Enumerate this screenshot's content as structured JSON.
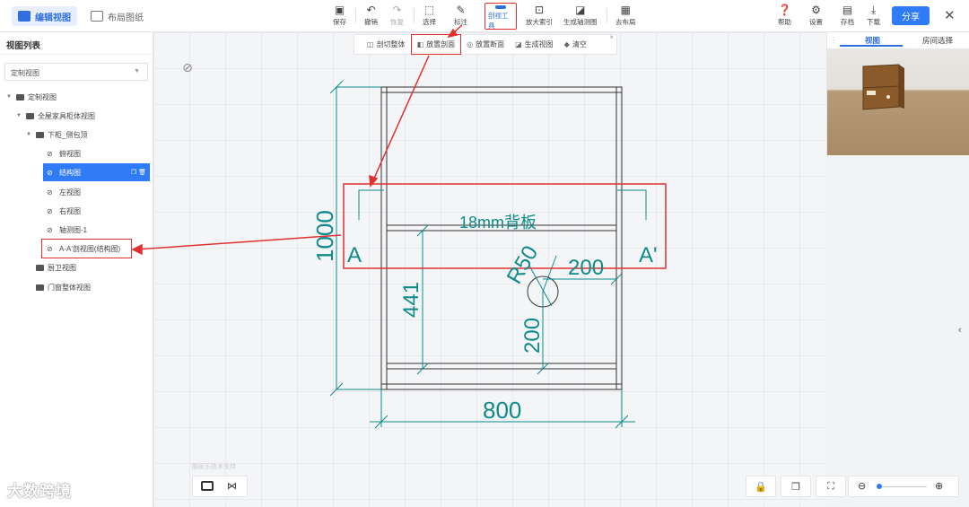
{
  "header": {
    "mode_tabs": [
      {
        "label": "编辑视图"
      },
      {
        "label": "布局图纸"
      }
    ],
    "tools": [
      {
        "label": "保存",
        "icon": "save-icon"
      },
      {
        "label": "撤销",
        "icon": "undo-icon"
      },
      {
        "label": "恢复",
        "icon": "redo-icon"
      },
      {
        "label": "选择",
        "icon": "select-icon"
      },
      {
        "label": "标注",
        "icon": "pen-icon"
      },
      {
        "label": "剖视工具",
        "icon": "section-tool-icon"
      },
      {
        "label": "放大索引",
        "icon": "magnify-index-icon"
      },
      {
        "label": "生成轴测图",
        "icon": "axonometric-icon"
      },
      {
        "label": "去布局",
        "icon": "layout-icon"
      }
    ],
    "right_tools": [
      {
        "label": "帮助",
        "icon": "help-icon"
      },
      {
        "label": "设置",
        "icon": "gear-icon"
      },
      {
        "label": "存档",
        "icon": "archive-icon"
      },
      {
        "label": "下载",
        "icon": "download-icon"
      }
    ],
    "share_label": "分享"
  },
  "section_toolbar": {
    "items": [
      {
        "label": "剖切整体"
      },
      {
        "label": "放置剖面"
      },
      {
        "label": "放置断面"
      },
      {
        "label": "生成视图"
      },
      {
        "label": "清空"
      }
    ]
  },
  "sidebar": {
    "title": "视图列表",
    "dropdown_value": "定制视图",
    "tree": [
      {
        "label": "定制视图"
      },
      {
        "label": "全屋家具柜体视图"
      },
      {
        "label": "下柜_侧包顶"
      },
      {
        "label": "俯视图"
      },
      {
        "label": "结构图"
      },
      {
        "label": "左视图"
      },
      {
        "label": "右视图"
      },
      {
        "label": "轴测图-1"
      },
      {
        "label": "A-A'剖视图(结构图)"
      },
      {
        "label": "厨卫视图"
      },
      {
        "label": "门窗整体视图"
      }
    ]
  },
  "right_panel": {
    "tabs": [
      {
        "label": "视图"
      },
      {
        "label": "房间选择"
      }
    ]
  },
  "drawing": {
    "dim_height": "1000",
    "dim_width": "800",
    "dim_441": "441",
    "dim_200_h": "200",
    "dim_200_v": "200",
    "radius": "R50",
    "back_panel": "18mm背板",
    "section_a": "A",
    "section_a_prime": "A'"
  },
  "watermark": "大数跨境",
  "faint_text": "酷家乐技术支持",
  "colors": {
    "accent": "#2f7cf6",
    "dimension": "#0e8a8a",
    "annotation_red": "#e03131"
  }
}
